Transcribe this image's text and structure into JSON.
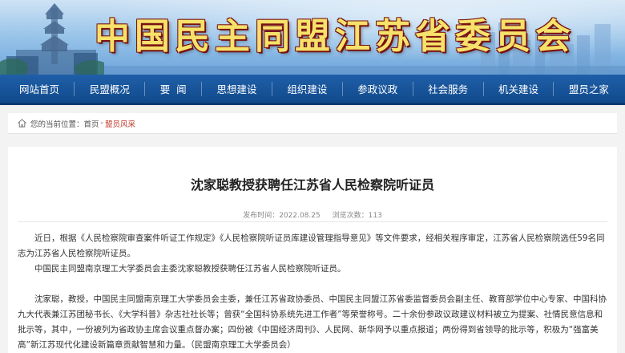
{
  "header": {
    "site_title": "中国民主同盟江苏省委员会"
  },
  "nav": {
    "items": [
      "网站首页",
      "民盟概况",
      "要  闻",
      "思想建设",
      "组织建设",
      "参政议政",
      "社会服务",
      "机关建设",
      "盟员之家"
    ]
  },
  "breadcrumb": {
    "label": "您的当前位置：",
    "home": "首页",
    "separator": "-",
    "current": "盟员风采"
  },
  "article": {
    "title": "沈家聪教授获聘任江苏省人民检察院听证员",
    "publish_label": "发布时间：",
    "publish_date": "2022.08.25",
    "views_label": "浏览次数：",
    "views": "113",
    "paragraphs": [
      "近日，根据《人民检察院审查案件听证工作规定》《人民检察院听证员库建设管理指导意见》等文件要求，经相关程序审定，江苏省人民检察院选任59名同志为江苏省人民检察院听证员。",
      "中国民主同盟南京理工大学委员会主委沈家聪教授获聘任江苏省人民检察院听证员。",
      "沈家聪，教授，中国民主同盟南京理工大学委员会主委，兼任江苏省政协委员、中国民主同盟江苏省委监督委员会副主任、教育部学位中心专家、中国科协九大代表兼江苏团秘书长、《大学科普》杂志社社长等；曾获“全国科协系统先进工作者”等荣誉称号。二十余份参政议政建议材料被立为提案、社情民意信息和批示等，其中，一份被列为省政协主席会议重点督办案；四份被《中国经济周刊》、人民网、新华网予以重点报道；两份得到省领导的批示等，积极为“强富美高”新江苏现代化建设新篇章贡献智慧和力量。（民盟南京理工大学委员会）"
    ]
  }
}
